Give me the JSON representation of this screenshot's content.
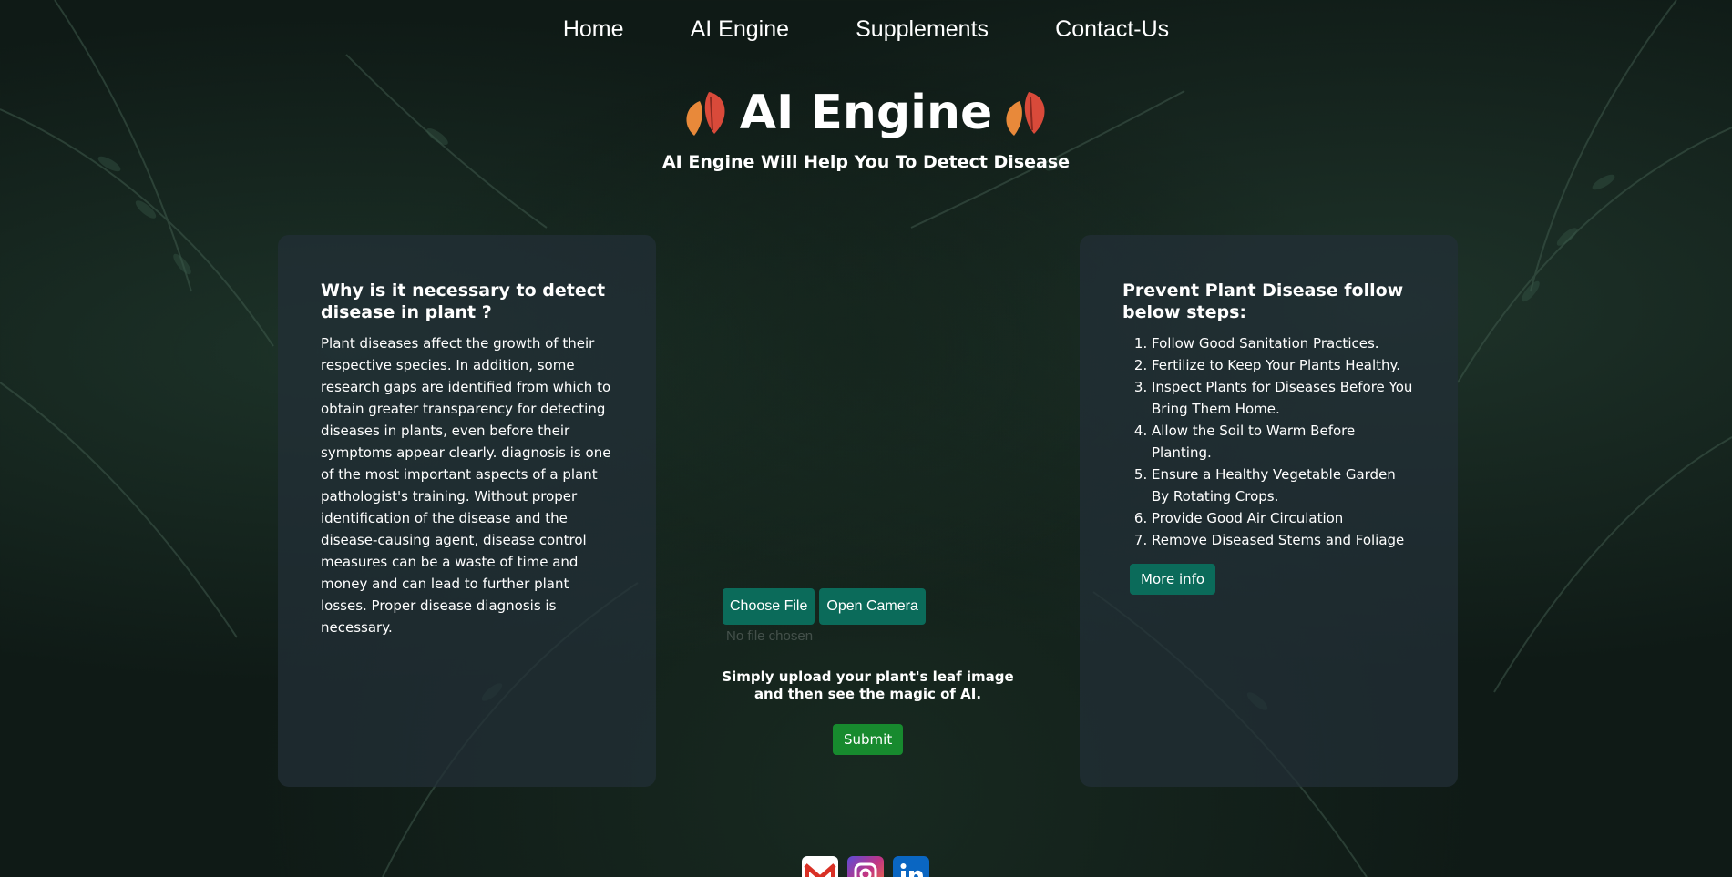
{
  "nav": {
    "items": [
      {
        "label": "Home"
      },
      {
        "label": "AI Engine"
      },
      {
        "label": "Supplements"
      },
      {
        "label": "Contact-Us"
      }
    ]
  },
  "hero": {
    "title": "AI Engine",
    "subtitle": "AI Engine Will Help You To Detect Disease",
    "icon": "leaf-icon"
  },
  "left_card": {
    "heading": "Why is it necessary to detect disease in plant ?",
    "body": "Plant diseases affect the growth of their respective species. In addition, some research gaps are identified from which to obtain greater transparency for detecting diseases in plants, even before their symptoms appear clearly. diagnosis is one of the most important aspects of a plant pathologist's training. Without proper identification of the disease and the disease-causing agent, disease control measures can be a waste of time and money and can lead to further plant losses. Proper disease diagnosis is necessary."
  },
  "right_card": {
    "heading": "Prevent Plant Disease follow below steps:",
    "steps": [
      "Follow Good Sanitation Practices.",
      "Fertilize to Keep Your Plants Healthy.",
      "Inspect Plants for Diseases Before You Bring Them Home.",
      "Allow the Soil to Warm Before Planting.",
      "Ensure a Healthy Vegetable Garden By Rotating Crops.",
      "Provide Good Air Circulation",
      "Remove Diseased Stems and Foliage"
    ],
    "more_info_label": "More info"
  },
  "upload": {
    "choose_file_label": "Choose File",
    "open_camera_label": "Open Camera",
    "no_file_text": "No file chosen",
    "instruction": "Simply upload your plant's leaf image and then see the magic of AI.",
    "submit_label": "Submit"
  },
  "social": {
    "icons": [
      "gmail-icon",
      "instagram-icon",
      "linkedin-icon"
    ]
  },
  "colors": {
    "button_teal": "#0b6b5a",
    "submit_green": "#178a2e",
    "card_bg": "#232f37"
  }
}
